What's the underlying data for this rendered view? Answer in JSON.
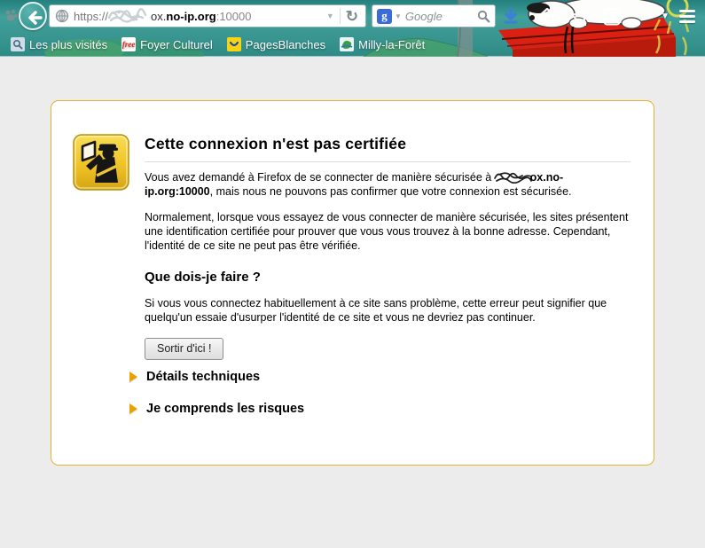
{
  "colors": {
    "theme_teal": "#3a9792",
    "box_border_gold": "#dfb430",
    "warning_icon_yellow": "#f2c93c",
    "expander_arrow": "#e8a200",
    "download_blue": "#3c7fd6",
    "doghouse_red": "#da2012"
  },
  "chrome": {
    "url_bar": {
      "prefix": "https://",
      "redacted_note": "scribbled-out host part",
      "host_tail": "ox.",
      "domain": "no-ip.org",
      "port": ":10000"
    },
    "search": {
      "placeholder": "Google"
    },
    "bookmarks": [
      {
        "label": "Les plus visités"
      },
      {
        "label": "Foyer Culturel"
      },
      {
        "label": "PagesBlanches"
      },
      {
        "label": "Milly-la-Forêt"
      }
    ]
  },
  "page": {
    "title": "Cette connexion n'est pas certifiée",
    "p1_before": "Vous avez demandé à Firefox de se connecter de manière sécurisée à ",
    "p1_host": "ox.no-ip.org:10000",
    "p1_after": ", mais nous ne pouvons pas confirmer que votre connexion est sécurisée.",
    "p2": "Normalement, lorsque vous essayez de vous connecter de manière sécurisée, les sites présentent une identification certifiée pour prouver que vous vous trouvez à la bonne adresse. Cependant, l'identité de ce site ne peut pas être vérifiée.",
    "what_heading": "Que dois-je faire ?",
    "p3": "Si vous vous connectez habituellement à ce site sans problème, cette erreur peut signifier que quelqu'un essaie d'usurper l'identité de ce site et vous ne devriez pas continuer.",
    "leave_button": "Sortir d'ici !",
    "expander_technical": "Détails techniques",
    "expander_risks": "Je comprends les risques"
  },
  "icons": {
    "url_dropdown": "▼",
    "reload": "↻",
    "search_dropdown": "▼",
    "google_logo": "g",
    "free_logo": "free",
    "toolbar_dropdown": "▼"
  }
}
